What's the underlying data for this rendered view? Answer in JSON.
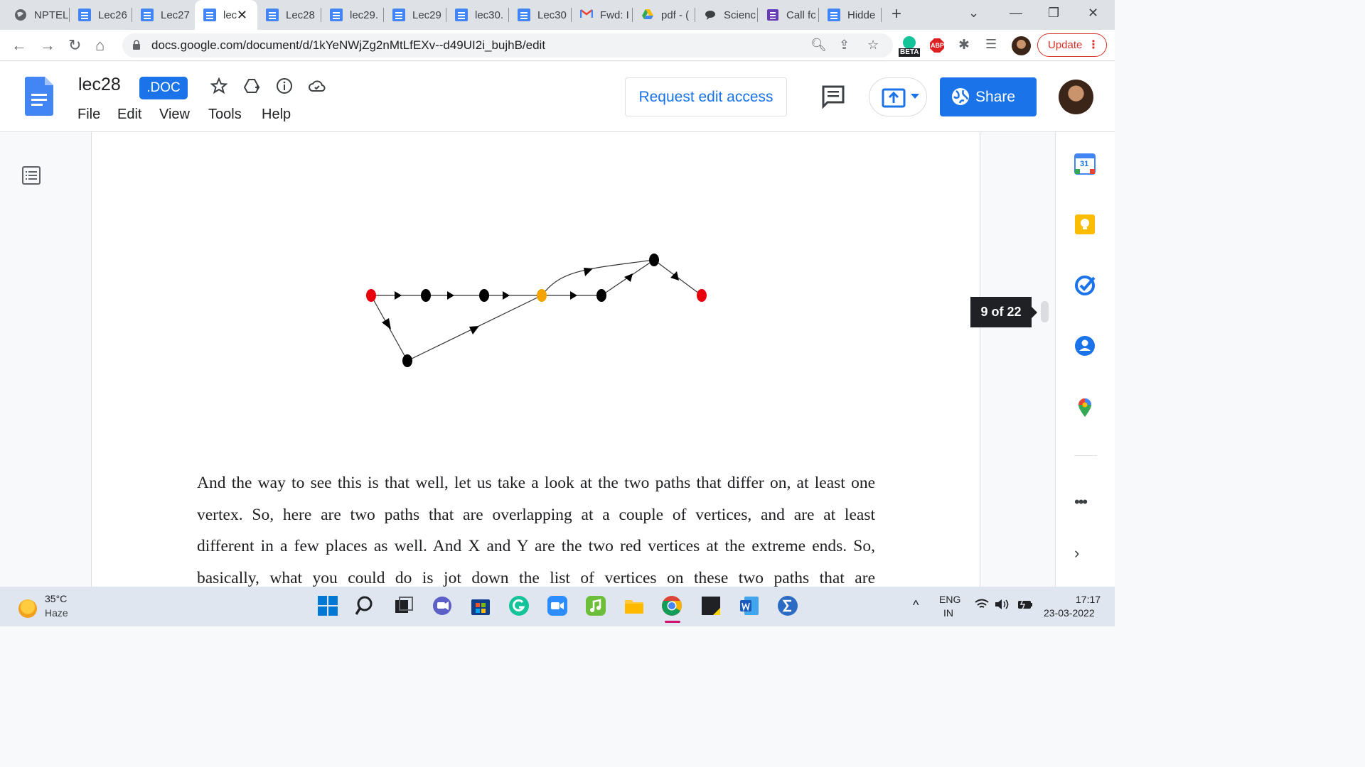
{
  "browser": {
    "tabs": [
      {
        "label": "NPTEL",
        "icon": "globe-icon"
      },
      {
        "label": "Lec26",
        "icon": "docs-icon"
      },
      {
        "label": "Lec27",
        "icon": "docs-icon"
      },
      {
        "label": "lec",
        "icon": "docs-icon",
        "active": true
      },
      {
        "label": "Lec28",
        "icon": "docs-icon"
      },
      {
        "label": "lec29.",
        "icon": "docs-icon"
      },
      {
        "label": "Lec29",
        "icon": "docs-icon"
      },
      {
        "label": "lec30.",
        "icon": "docs-icon"
      },
      {
        "label": "Lec30",
        "icon": "docs-icon"
      },
      {
        "label": "Fwd: I",
        "icon": "gmail-icon"
      },
      {
        "label": "pdf - (",
        "icon": "drive-icon"
      },
      {
        "label": "Scienc",
        "icon": "chat-icon"
      },
      {
        "label": "Call fc",
        "icon": "forms-icon"
      },
      {
        "label": "Hidde",
        "icon": "docs-icon"
      }
    ],
    "url": "docs.google.com/document/d/1kYeNWjZg2nMtLfEXv--d49UI2i_bujhB/edit",
    "update_label": "Update",
    "beta_label": "BETA",
    "abp_label": "ABP"
  },
  "docs": {
    "title": "lec28",
    "badge": ".DOC",
    "menu": [
      "File",
      "Edit",
      "View",
      "Tools",
      "Help"
    ],
    "request_edit": "Request edit access",
    "share": "Share"
  },
  "page_indicator": "9 of 22",
  "body_lines": [
    "And the way to see this is that well, let us take a look at the two paths that differ on, at least one",
    "vertex. So, here are two paths that are overlapping at a couple of vertices, and are at least",
    "different in a few places as well. And X and Y are the two red vertices at the extreme ends. So,",
    "basically, what you could do is jot down the list of vertices on these two paths that are"
  ],
  "figure": {
    "vertex_colors": {
      "endpoint": "#e8000b",
      "junction": "#f5a300",
      "normal": "#000000"
    }
  },
  "side_panel": [
    "calendar-icon",
    "keep-icon",
    "tasks-icon",
    "contacts-icon",
    "maps-icon",
    "more-icon",
    "expand-icon"
  ],
  "calendar_day": "31",
  "taskbar": {
    "temperature": "35°C",
    "weather": "Haze",
    "lang_top": "ENG",
    "lang_bottom": "IN",
    "time": "17:17",
    "date": "23-03-2022"
  }
}
